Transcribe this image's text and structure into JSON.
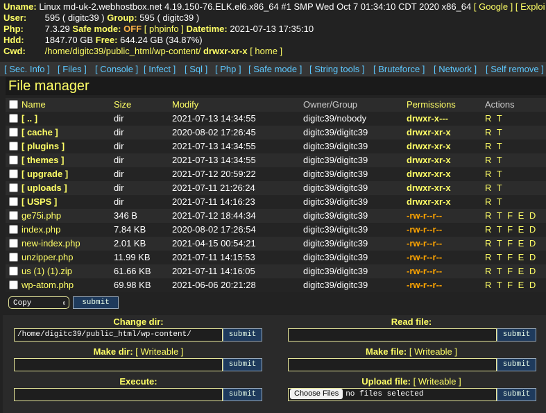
{
  "sysinfo": {
    "uname_label": "Uname:",
    "uname_value": "Linux md-uk-2.webhostbox.net 4.19.150-76.ELK.el6.x86_64 #1 SMP Wed Oct 7 01:34:10 CDT 2020 x86_64",
    "google_link": "[ Google ]",
    "exploit_link": "[ Exploi",
    "user_label": "User:",
    "user_value": "595 ( digitc39 )",
    "group_label": "Group:",
    "group_value": "595 ( digitc39 )",
    "php_label": "Php:",
    "php_value": "7.3.29",
    "safe_label": "Safe mode:",
    "safe_value": "OFF",
    "phpinfo_link": "[ phpinfo ]",
    "datetime_label": "Datetime:",
    "datetime_value": "2021-07-13 17:35:10",
    "hdd_label": "Hdd:",
    "hdd_value": "1847.70 GB",
    "free_label": "Free:",
    "free_value": "644.24 GB (34.87%)",
    "cwd_label": "Cwd:",
    "cwd_value": "/home/digitc39/public_html/wp-content/",
    "cwd_perm": "drwxr-xr-x",
    "home_link": "[ home ]"
  },
  "nav": [
    "[ Sec. Info ]",
    "[ Files ]",
    "[ Console ]",
    "[ Infect ]",
    "[ Sql ]",
    "[ Php ]",
    "[ Safe mode ]",
    "[ String tools ]",
    "[ Bruteforce ]",
    "[ Network ]",
    "[ Self remove ]"
  ],
  "file_manager": {
    "title": "File manager",
    "headers": {
      "name": "Name",
      "size": "Size",
      "modify": "Modify",
      "owner": "Owner/Group",
      "perms": "Permissions",
      "actions": "Actions"
    },
    "rows": [
      {
        "name": "[ .. ]",
        "size": "dir",
        "modify": "2021-07-13 14:34:55",
        "owner": "digitc39/nobody",
        "perms": "drwxr-x---",
        "actions": "R T"
      },
      {
        "name": "[ cache ]",
        "size": "dir",
        "modify": "2020-08-02 17:26:45",
        "owner": "digitc39/digitc39",
        "perms": "drwxr-xr-x",
        "actions": "R T"
      },
      {
        "name": "[ plugins ]",
        "size": "dir",
        "modify": "2021-07-13 14:34:55",
        "owner": "digitc39/digitc39",
        "perms": "drwxr-xr-x",
        "actions": "R T"
      },
      {
        "name": "[ themes ]",
        "size": "dir",
        "modify": "2021-07-13 14:34:55",
        "owner": "digitc39/digitc39",
        "perms": "drwxr-xr-x",
        "actions": "R T"
      },
      {
        "name": "[ upgrade ]",
        "size": "dir",
        "modify": "2021-07-12 20:59:22",
        "owner": "digitc39/digitc39",
        "perms": "drwxr-xr-x",
        "actions": "R T"
      },
      {
        "name": "[ uploads ]",
        "size": "dir",
        "modify": "2021-07-11 21:26:24",
        "owner": "digitc39/digitc39",
        "perms": "drwxr-xr-x",
        "actions": "R T"
      },
      {
        "name": "[ USPS ]",
        "size": "dir",
        "modify": "2021-07-11 14:16:23",
        "owner": "digitc39/digitc39",
        "perms": "drwxr-xr-x",
        "actions": "R T"
      },
      {
        "name": "ge75i.php",
        "size": "346 B",
        "modify": "2021-07-12 18:44:34",
        "owner": "digitc39/digitc39",
        "perms": "-rw-r--r--",
        "actions": "R T F E D"
      },
      {
        "name": "index.php",
        "size": "7.84 KB",
        "modify": "2020-08-02 17:26:54",
        "owner": "digitc39/digitc39",
        "perms": "-rw-r--r--",
        "actions": "R T F E D"
      },
      {
        "name": "new-index.php",
        "size": "2.01 KB",
        "modify": "2021-04-15 00:54:21",
        "owner": "digitc39/digitc39",
        "perms": "-rw-r--r--",
        "actions": "R T F E D"
      },
      {
        "name": "unzipper.php",
        "size": "11.99 KB",
        "modify": "2021-07-11 14:15:53",
        "owner": "digitc39/digitc39",
        "perms": "-rw-r--r--",
        "actions": "R T F E D"
      },
      {
        "name": "us (1) (1).zip",
        "size": "61.66 KB",
        "modify": "2021-07-11 14:16:05",
        "owner": "digitc39/digitc39",
        "perms": "-rw-r--r--",
        "actions": "R T F E D"
      },
      {
        "name": "wp-atom.php",
        "size": "69.98 KB",
        "modify": "2021-06-06 20:21:28",
        "owner": "digitc39/digitc39",
        "perms": "-rw-r--r--",
        "actions": "R T F E D"
      }
    ],
    "action_select": "Copy",
    "submit_label": "submit"
  },
  "forms": {
    "change_dir": {
      "label": "Change dir:",
      "value": "/home/digitc39/public_html/wp-content/",
      "submit": "submit"
    },
    "read_file": {
      "label": "Read file:",
      "value": "",
      "submit": "submit"
    },
    "make_dir": {
      "label": "Make dir:",
      "note": "[ Writeable ]",
      "value": "",
      "submit": "submit"
    },
    "make_file": {
      "label": "Make file:",
      "note": "[ Writeable ]",
      "value": "",
      "submit": "submit"
    },
    "execute": {
      "label": "Execute:",
      "value": "",
      "submit": "submit"
    },
    "upload_file": {
      "label": "Upload file:",
      "note": "[ Writeable ]",
      "choose": "Choose Files",
      "status": "no files selected",
      "submit": "submit"
    }
  }
}
